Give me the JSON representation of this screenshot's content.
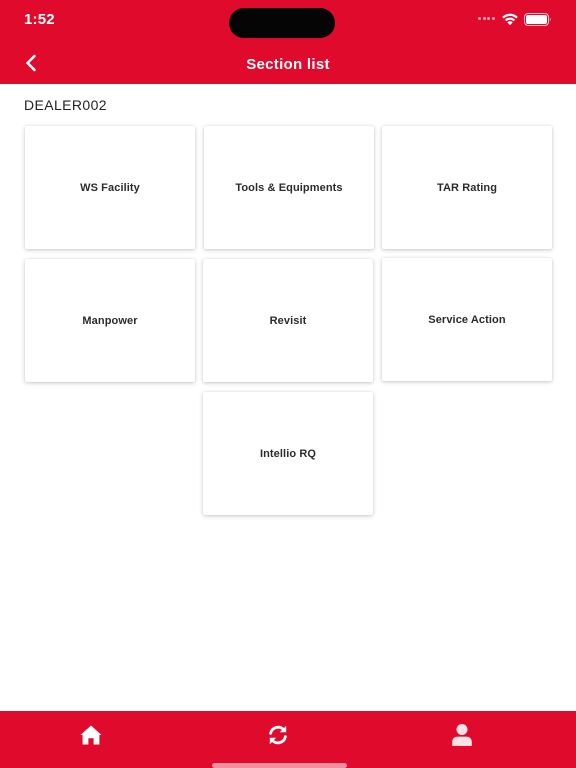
{
  "status_bar": {
    "time": "1:52"
  },
  "header": {
    "title": "Section list",
    "back_icon": "chevron-left-icon"
  },
  "dealer": {
    "code": "DEALER002"
  },
  "sections": [
    {
      "label": "WS Facility"
    },
    {
      "label": "Tools & Equipments"
    },
    {
      "label": "TAR Rating"
    },
    {
      "label": "Manpower"
    },
    {
      "label": "Revisit"
    },
    {
      "label": "Service Action"
    },
    {
      "label": "Intellio RQ"
    }
  ],
  "bottom_nav": {
    "items": [
      {
        "icon": "home-icon"
      },
      {
        "icon": "sync-icon"
      },
      {
        "icon": "profile-icon"
      }
    ]
  },
  "colors": {
    "brand_red": "#e00a2c",
    "card_text": "#2c2c2c",
    "background": "#ffffff"
  }
}
